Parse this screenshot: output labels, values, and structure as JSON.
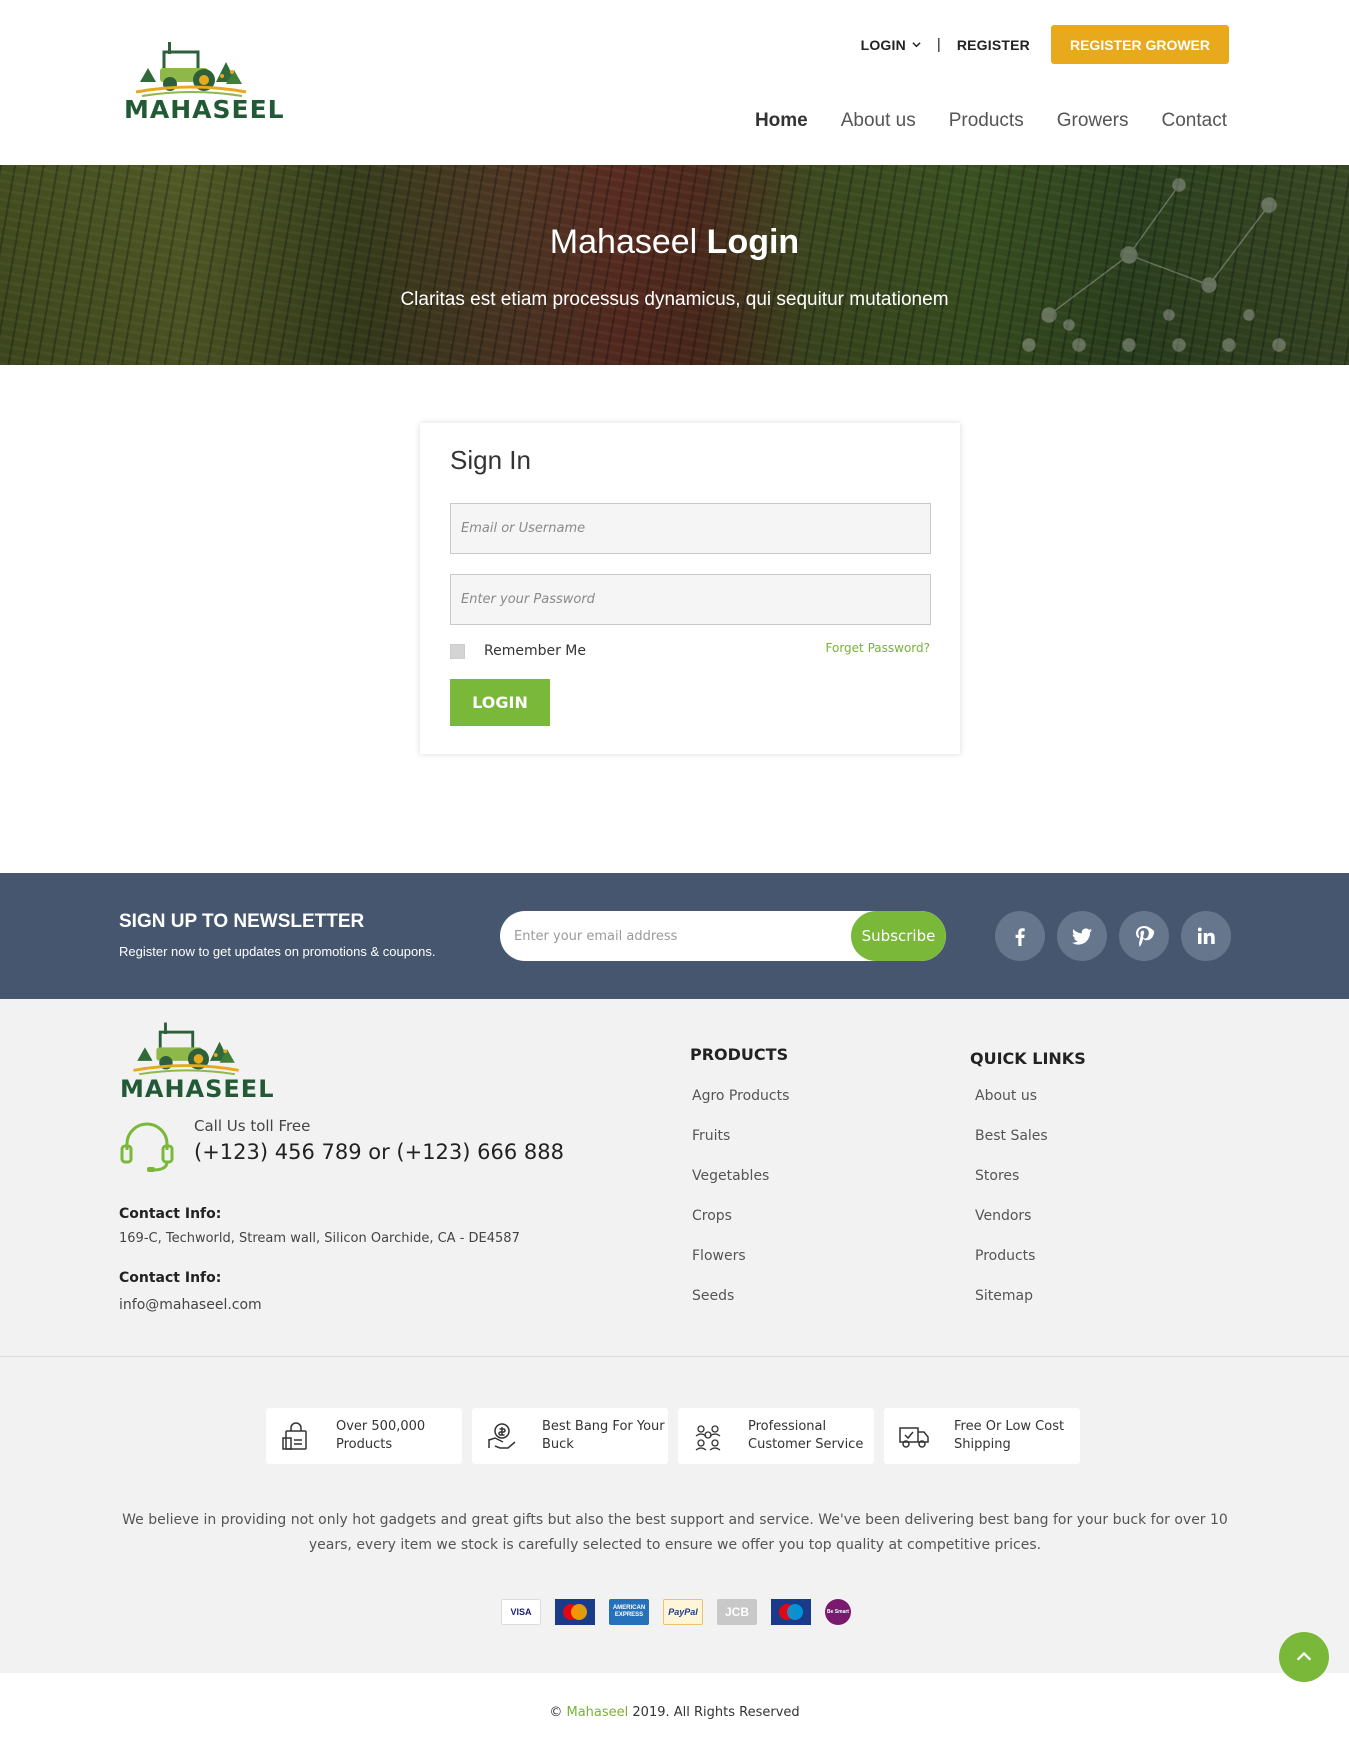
{
  "header": {
    "logo_text": "MAHASEEL",
    "top_links": {
      "login": "LOGIN",
      "separator": "|",
      "register": "REGISTER",
      "register_grower": "REGISTER GROWER"
    },
    "nav": [
      {
        "label": "Home",
        "active": true
      },
      {
        "label": "About us"
      },
      {
        "label": "Products"
      },
      {
        "label": "Growers"
      },
      {
        "label": "Contact"
      }
    ]
  },
  "hero": {
    "title_light": "Mahaseel",
    "title_bold": "Login",
    "subtitle": "Claritas est etiam processus dynamicus, qui sequitur mutationem"
  },
  "signin": {
    "heading": "Sign In",
    "username_placeholder": "Email or Username",
    "password_placeholder": "Enter your Password",
    "remember_label": "Remember Me",
    "forgot_label": "Forget Password?",
    "login_button": "LOGIN"
  },
  "newsletter": {
    "title": "SIGN UP TO NEWSLETTER",
    "subtitle": "Register now to get updates on promotions & coupons.",
    "email_placeholder": "Enter your email address",
    "subscribe_label": "Subscribe",
    "socials": [
      "facebook-icon",
      "twitter-icon",
      "pinterest-icon",
      "linkedin-icon"
    ]
  },
  "footer": {
    "logo_text": "MAHASEEL",
    "call_label": "Call Us toll Free",
    "call_numbers": "(+123) 456 789 or (+123) 666 888",
    "contact_heading_1": "Contact Info:",
    "address": "169-C, Techworld, Stream wall, Silicon Oarchide, CA - DE4587",
    "contact_heading_2": "Contact Info:",
    "email": "info@mahaseel.com",
    "products_heading": "PRODUCTS",
    "products": [
      "Agro Products",
      "Fruits",
      "Vegetables",
      "Crops",
      "Flowers",
      "Seeds"
    ],
    "quick_heading": "QUICK LINKS",
    "quick_links": [
      "About us",
      "Best Sales",
      "Stores",
      "Vendors",
      "Products",
      "Sitemap"
    ],
    "features": [
      {
        "line1": "Over 500,000",
        "line2": "Products",
        "icon": "shopping-bag-icon"
      },
      {
        "line1": "Best Bang For Your",
        "line2": "Buck",
        "icon": "money-hand-icon"
      },
      {
        "line1": "Professional",
        "line2": "Customer Service",
        "icon": "team-icon"
      },
      {
        "line1": "Free Or Low Cost",
        "line2": "Shipping",
        "icon": "truck-icon"
      }
    ],
    "about_text": "We believe in providing not only hot gadgets and great gifts but also the best support and service. We've been delivering best bang for your buck for over 10 years, every item we stock is carefully selected to ensure we offer you top quality at competitive prices.",
    "payments": [
      "VISA",
      "MasterCard",
      "AMERICAN EXPRESS",
      "PayPal",
      "JCB",
      "Maestro",
      "Be Smart"
    ],
    "copyright_prefix": "©",
    "copyright_brand": "Mahaseel",
    "copyright_suffix": "2019. All Rights Reserved"
  },
  "colors": {
    "accent_green": "#7ab83a",
    "accent_orange": "#e8a91c",
    "newsletter_bg": "#46566f",
    "footer_bg": "#f2f2f2"
  }
}
